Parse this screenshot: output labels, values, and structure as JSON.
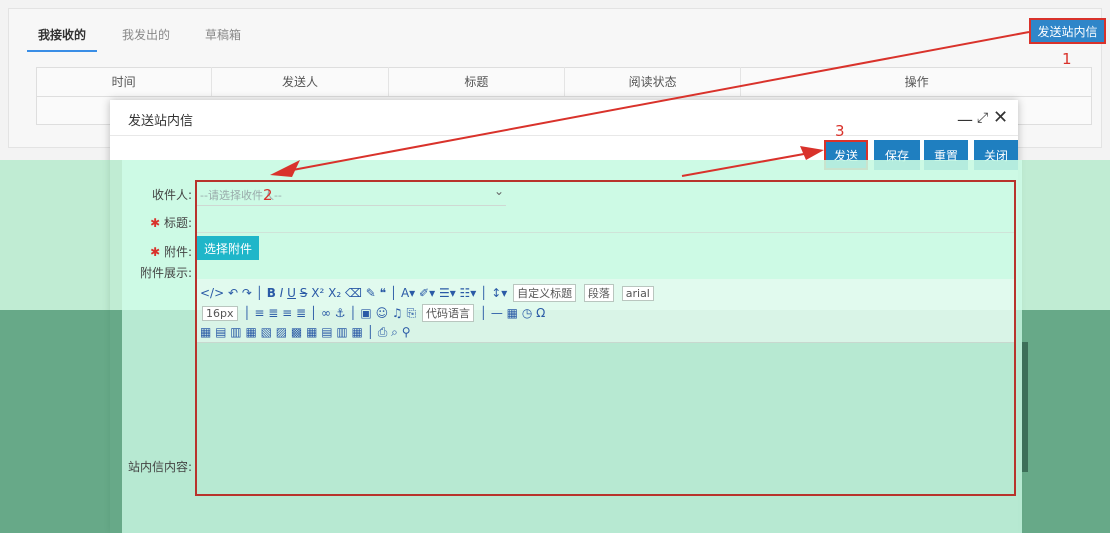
{
  "tabs": [
    {
      "label": "我接收的",
      "active": true
    },
    {
      "label": "我发出的",
      "active": false
    },
    {
      "label": "草稿箱",
      "active": false
    }
  ],
  "header_button": "发送站内信",
  "table": {
    "columns": [
      "时间",
      "发送人",
      "标题",
      "阅读状态",
      "操作"
    ]
  },
  "dialog": {
    "title": "发送站内信",
    "controls": {
      "minimize": "—",
      "maximize": "⤢",
      "close": "✕"
    },
    "buttons": {
      "send": "发送",
      "save": "保存",
      "reset": "重置",
      "close": "关闭"
    },
    "form": {
      "recipient_label": "收件人:",
      "recipient_placeholder": "--请选择收件人--",
      "subject_label": "标题:",
      "attachment_label": "附件:",
      "attachment_button": "选择附件",
      "attachment_display_label": "附件展示:",
      "content_label": "站内信内容:"
    },
    "editor": {
      "font_size": "16px",
      "custom_title": "自定义标题",
      "paragraph": "段落",
      "font_family": "arial",
      "code_lang": "代码语言"
    }
  },
  "annotations": {
    "step1": "1",
    "step2": "2",
    "step3": "3"
  },
  "colors": {
    "primary_button": "#1f7fc0",
    "attach_button": "#1fb6c9",
    "annotation_red": "#d9322b",
    "overlay_green": "#46966e"
  }
}
